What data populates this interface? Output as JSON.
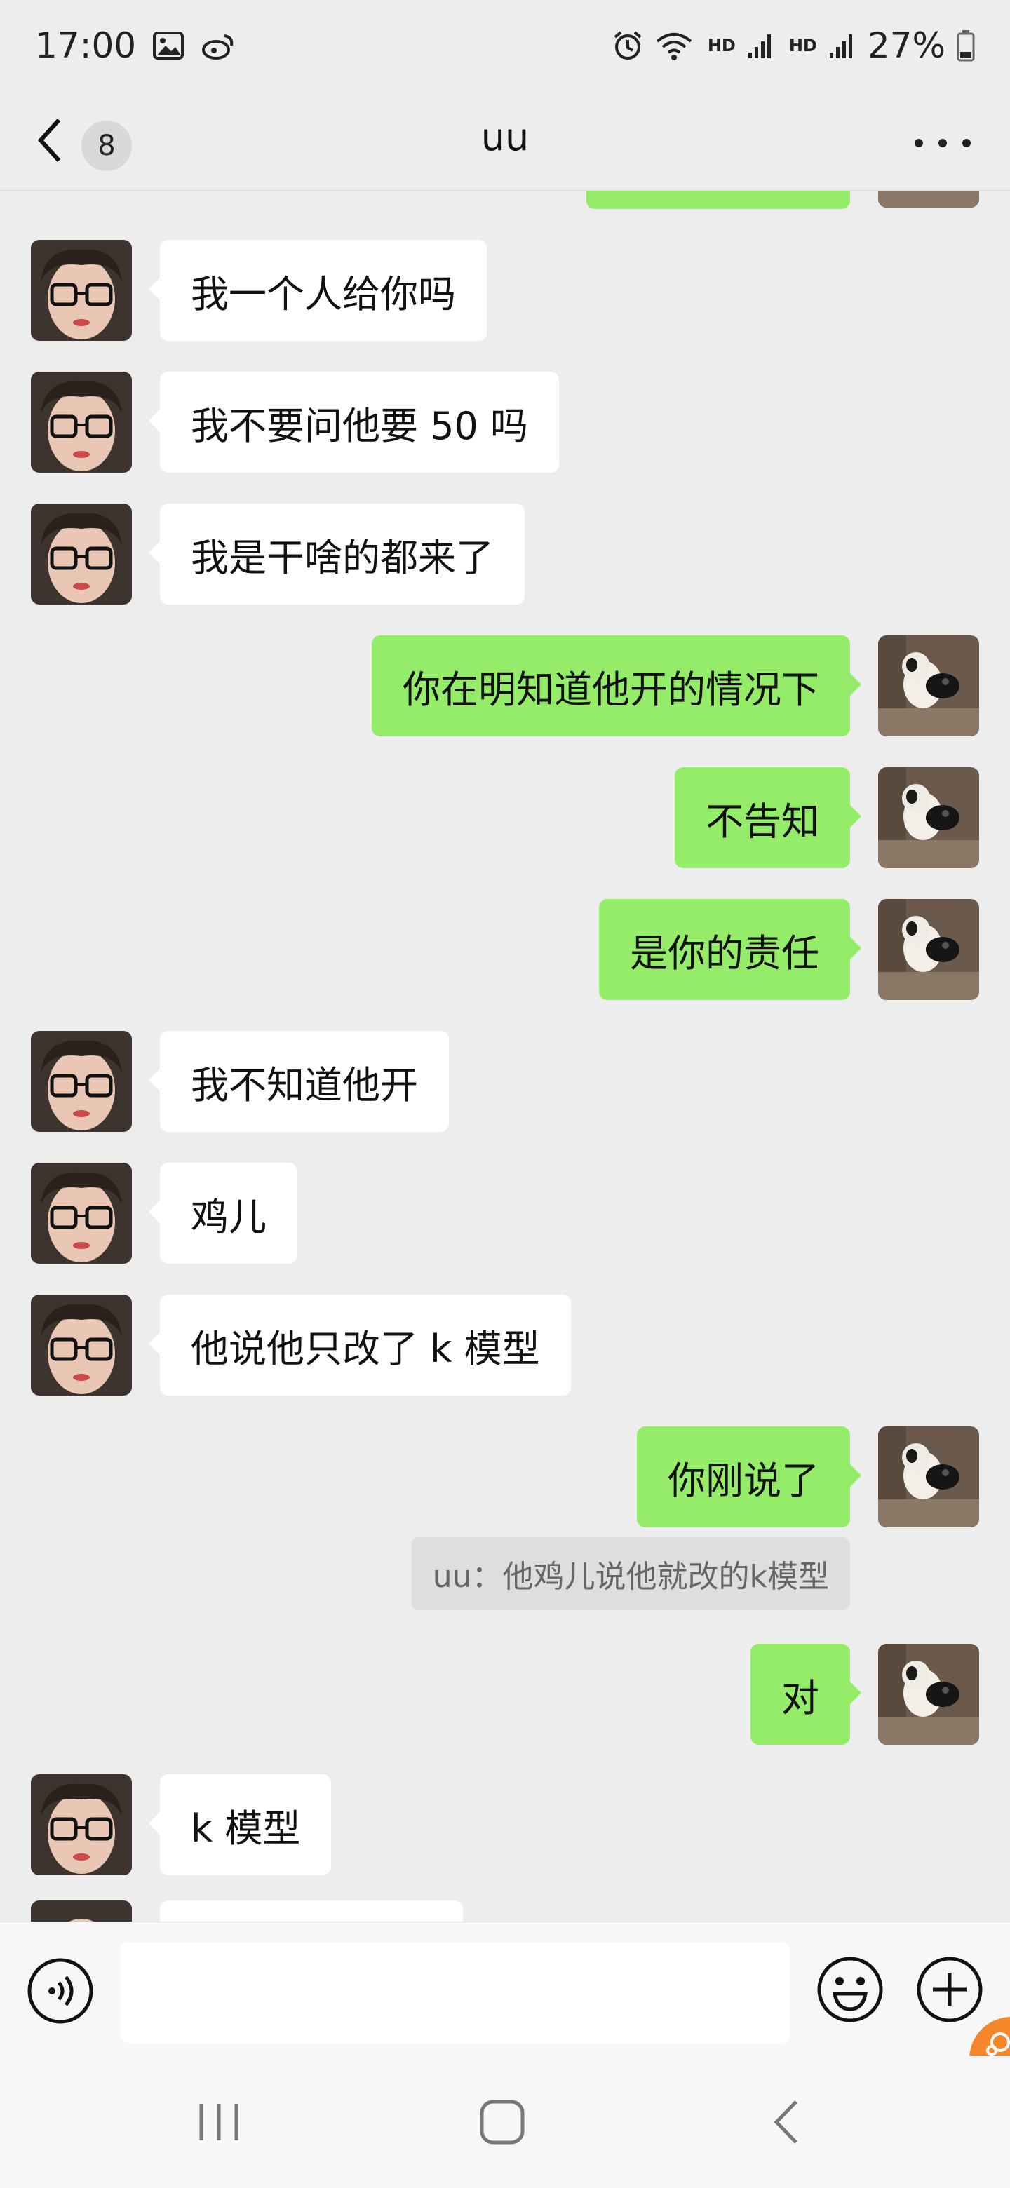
{
  "status_bar": {
    "time": "17:00",
    "hd1": "HD",
    "hd2": "HD",
    "battery": "27%",
    "icons": [
      "image-icon",
      "weibo-icon",
      "alarm-icon",
      "wifi-icon",
      "signal-icon",
      "signal-icon",
      "battery-icon"
    ]
  },
  "header": {
    "back_icon": "chevron-left-icon",
    "unread_count": "8",
    "title": "uu",
    "more_icon": "more-dots-icon"
  },
  "messages": [
    {
      "side": "left",
      "text": "我一个人给你吗"
    },
    {
      "side": "left",
      "text": "我不要问他要 50 吗"
    },
    {
      "side": "left",
      "text": "我是干啥的都来了"
    },
    {
      "side": "right",
      "text": "你在明知道他开的情况下"
    },
    {
      "side": "right",
      "text": "不告知"
    },
    {
      "side": "right",
      "text": "是你的责任"
    },
    {
      "side": "left",
      "text": "我不知道他开"
    },
    {
      "side": "left",
      "text": "鸡儿"
    },
    {
      "side": "left",
      "text": "他说他只改了 k 模型"
    },
    {
      "side": "right",
      "text": "你刚说了"
    },
    {
      "side": "quote",
      "text": "uu：他鸡儿说他就改的k模型"
    },
    {
      "side": "right",
      "text": "对"
    },
    {
      "side": "left",
      "text": "k 模型"
    }
  ],
  "input_bar": {
    "voice_icon": "voice-icon",
    "input_value": "",
    "emoji_icon": "emoji-icon",
    "plus_icon": "plus-icon"
  },
  "nav_bar": {
    "icons": [
      "recents-icon",
      "home-icon",
      "back-icon"
    ]
  },
  "colors": {
    "background": "#ededed",
    "outgoing_bubble": "#95ec69",
    "incoming_bubble": "#ffffff",
    "widget": "#f5862a"
  }
}
